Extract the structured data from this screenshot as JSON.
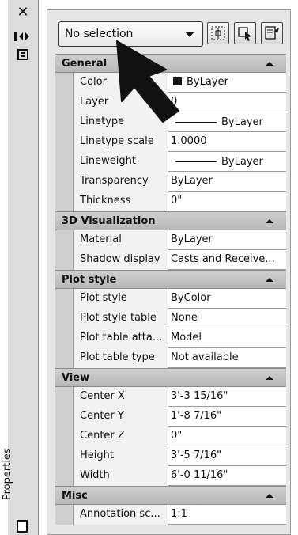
{
  "palette": {
    "title": "Properties"
  },
  "toolbar": {
    "selection": "No selection",
    "buttons": [
      "toggle-pickadd-icon",
      "select-objects-icon",
      "quick-select-icon"
    ]
  },
  "sections": [
    {
      "title": "General",
      "rows": [
        {
          "name": "Color",
          "value": "ByLayer"
        },
        {
          "name": "Layer",
          "value": "0"
        },
        {
          "name": "Linetype",
          "value": "ByLayer"
        },
        {
          "name": "Linetype scale",
          "value": "1.0000"
        },
        {
          "name": "Lineweight",
          "value": "ByLayer"
        },
        {
          "name": "Transparency",
          "value": "ByLayer"
        },
        {
          "name": "Thickness",
          "value": "0\""
        }
      ]
    },
    {
      "title": "3D Visualization",
      "rows": [
        {
          "name": "Material",
          "value": "ByLayer"
        },
        {
          "name": "Shadow display",
          "value": "Casts and Receive..."
        }
      ]
    },
    {
      "title": "Plot style",
      "rows": [
        {
          "name": "Plot style",
          "value": "ByColor"
        },
        {
          "name": "Plot style table",
          "value": "None"
        },
        {
          "name": "Plot table atta...",
          "value": "Model"
        },
        {
          "name": "Plot table type",
          "value": "Not available"
        }
      ]
    },
    {
      "title": "View",
      "rows": [
        {
          "name": "Center X",
          "value": "3'-3 15/16\""
        },
        {
          "name": "Center Y",
          "value": "1'-8 7/16\""
        },
        {
          "name": "Center Z",
          "value": "0\""
        },
        {
          "name": "Height",
          "value": "3'-5 7/16\""
        },
        {
          "name": "Width",
          "value": "6'-0 11/16\""
        }
      ]
    },
    {
      "title": "Misc",
      "rows": [
        {
          "name": "Annotation sc...",
          "value": "1:1"
        }
      ]
    }
  ]
}
